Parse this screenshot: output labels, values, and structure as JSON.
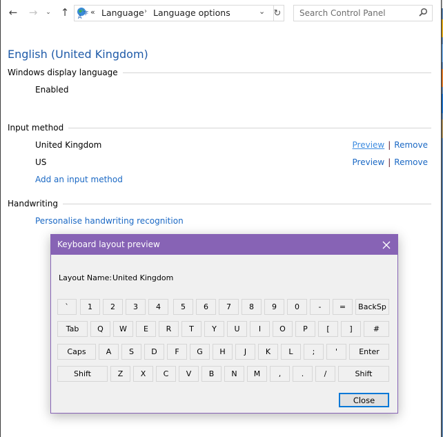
{
  "nav": {
    "back_icon": "arrow-left-icon",
    "forward_icon": "arrow-right-icon",
    "recent_icon": "chevron-down-icon",
    "up_icon": "arrow-up-icon",
    "breadcrumb_overflow": "«",
    "breadcrumb": [
      "Language",
      "Language options"
    ],
    "search_placeholder": "Search Control Panel"
  },
  "page": {
    "title": "English (United Kingdom)",
    "sections": {
      "display_language": {
        "heading": "Windows display language",
        "status": "Enabled"
      },
      "input_method": {
        "heading": "Input method",
        "methods": [
          {
            "name": "United Kingdom",
            "preview": "Preview",
            "remove": "Remove"
          },
          {
            "name": "US",
            "preview": "Preview",
            "remove": "Remove"
          }
        ],
        "add_link": "Add an input method",
        "separator": "|"
      },
      "handwriting": {
        "heading": "Handwriting",
        "link": "Personalise handwriting recognition"
      }
    }
  },
  "dialog": {
    "title": "Keyboard layout preview",
    "layout_name_label": "Layout Name:",
    "layout_name_value": "United Kingdom",
    "close_button": "Close",
    "title_bar_color": "#8763b5",
    "keyboard_rows": [
      [
        "`",
        "1",
        "2",
        "3",
        "4",
        "5",
        "6",
        "7",
        "8",
        "9",
        "0",
        "-",
        "=",
        "BackSp"
      ],
      [
        "Tab",
        "Q",
        "W",
        "E",
        "R",
        "T",
        "Y",
        "U",
        "I",
        "O",
        "P",
        "[",
        "]",
        "#"
      ],
      [
        "Caps",
        "A",
        "S",
        "D",
        "F",
        "G",
        "H",
        "J",
        "K",
        "L",
        ";",
        "'",
        "Enter"
      ],
      [
        "Shift",
        "Z",
        "X",
        "C",
        "V",
        "B",
        "N",
        "M",
        ",",
        ".",
        "/",
        "Shift"
      ]
    ]
  }
}
